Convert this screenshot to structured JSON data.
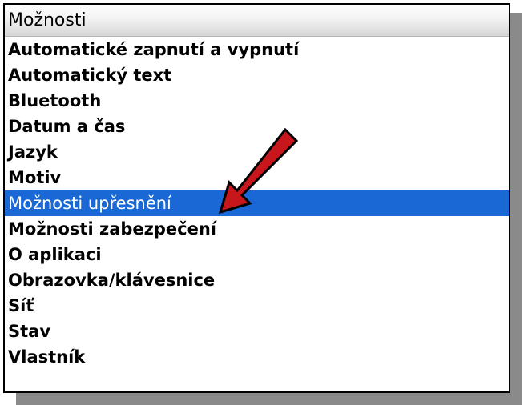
{
  "title": "Možnosti",
  "items": [
    {
      "label": "Automatické zapnutí a vypnutí"
    },
    {
      "label": "Automatický text"
    },
    {
      "label": "Bluetooth"
    },
    {
      "label": "Datum a čas"
    },
    {
      "label": "Jazyk"
    },
    {
      "label": "Motiv"
    },
    {
      "label": "Možnosti upřesnění"
    },
    {
      "label": "Možnosti zabezpečení"
    },
    {
      "label": "O aplikaci"
    },
    {
      "label": "Obrazovka/klávesnice"
    },
    {
      "label": "Síť"
    },
    {
      "label": "Stav"
    },
    {
      "label": "Vlastník"
    }
  ],
  "selected_index": 6,
  "colors": {
    "selection": "#1a68d6",
    "arrow": "#c8171c"
  },
  "annotation": {
    "icon": "red-arrow-icon"
  }
}
